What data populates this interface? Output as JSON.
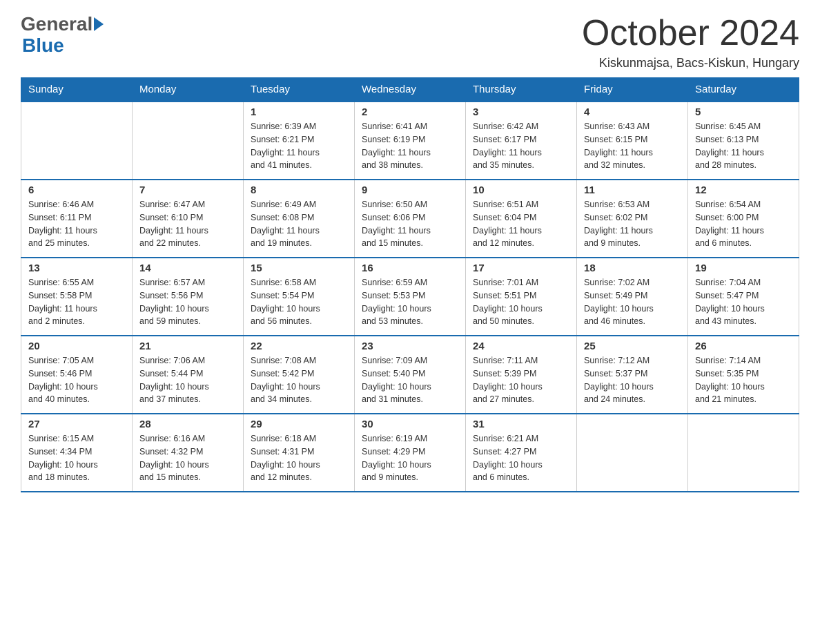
{
  "header": {
    "logo_general": "General",
    "logo_blue": "Blue",
    "month_title": "October 2024",
    "location": "Kiskunmajsa, Bacs-Kiskun, Hungary"
  },
  "weekdays": [
    "Sunday",
    "Monday",
    "Tuesday",
    "Wednesday",
    "Thursday",
    "Friday",
    "Saturday"
  ],
  "weeks": [
    [
      {
        "day": "",
        "info": ""
      },
      {
        "day": "",
        "info": ""
      },
      {
        "day": "1",
        "info": "Sunrise: 6:39 AM\nSunset: 6:21 PM\nDaylight: 11 hours\nand 41 minutes."
      },
      {
        "day": "2",
        "info": "Sunrise: 6:41 AM\nSunset: 6:19 PM\nDaylight: 11 hours\nand 38 minutes."
      },
      {
        "day": "3",
        "info": "Sunrise: 6:42 AM\nSunset: 6:17 PM\nDaylight: 11 hours\nand 35 minutes."
      },
      {
        "day": "4",
        "info": "Sunrise: 6:43 AM\nSunset: 6:15 PM\nDaylight: 11 hours\nand 32 minutes."
      },
      {
        "day": "5",
        "info": "Sunrise: 6:45 AM\nSunset: 6:13 PM\nDaylight: 11 hours\nand 28 minutes."
      }
    ],
    [
      {
        "day": "6",
        "info": "Sunrise: 6:46 AM\nSunset: 6:11 PM\nDaylight: 11 hours\nand 25 minutes."
      },
      {
        "day": "7",
        "info": "Sunrise: 6:47 AM\nSunset: 6:10 PM\nDaylight: 11 hours\nand 22 minutes."
      },
      {
        "day": "8",
        "info": "Sunrise: 6:49 AM\nSunset: 6:08 PM\nDaylight: 11 hours\nand 19 minutes."
      },
      {
        "day": "9",
        "info": "Sunrise: 6:50 AM\nSunset: 6:06 PM\nDaylight: 11 hours\nand 15 minutes."
      },
      {
        "day": "10",
        "info": "Sunrise: 6:51 AM\nSunset: 6:04 PM\nDaylight: 11 hours\nand 12 minutes."
      },
      {
        "day": "11",
        "info": "Sunrise: 6:53 AM\nSunset: 6:02 PM\nDaylight: 11 hours\nand 9 minutes."
      },
      {
        "day": "12",
        "info": "Sunrise: 6:54 AM\nSunset: 6:00 PM\nDaylight: 11 hours\nand 6 minutes."
      }
    ],
    [
      {
        "day": "13",
        "info": "Sunrise: 6:55 AM\nSunset: 5:58 PM\nDaylight: 11 hours\nand 2 minutes."
      },
      {
        "day": "14",
        "info": "Sunrise: 6:57 AM\nSunset: 5:56 PM\nDaylight: 10 hours\nand 59 minutes."
      },
      {
        "day": "15",
        "info": "Sunrise: 6:58 AM\nSunset: 5:54 PM\nDaylight: 10 hours\nand 56 minutes."
      },
      {
        "day": "16",
        "info": "Sunrise: 6:59 AM\nSunset: 5:53 PM\nDaylight: 10 hours\nand 53 minutes."
      },
      {
        "day": "17",
        "info": "Sunrise: 7:01 AM\nSunset: 5:51 PM\nDaylight: 10 hours\nand 50 minutes."
      },
      {
        "day": "18",
        "info": "Sunrise: 7:02 AM\nSunset: 5:49 PM\nDaylight: 10 hours\nand 46 minutes."
      },
      {
        "day": "19",
        "info": "Sunrise: 7:04 AM\nSunset: 5:47 PM\nDaylight: 10 hours\nand 43 minutes."
      }
    ],
    [
      {
        "day": "20",
        "info": "Sunrise: 7:05 AM\nSunset: 5:46 PM\nDaylight: 10 hours\nand 40 minutes."
      },
      {
        "day": "21",
        "info": "Sunrise: 7:06 AM\nSunset: 5:44 PM\nDaylight: 10 hours\nand 37 minutes."
      },
      {
        "day": "22",
        "info": "Sunrise: 7:08 AM\nSunset: 5:42 PM\nDaylight: 10 hours\nand 34 minutes."
      },
      {
        "day": "23",
        "info": "Sunrise: 7:09 AM\nSunset: 5:40 PM\nDaylight: 10 hours\nand 31 minutes."
      },
      {
        "day": "24",
        "info": "Sunrise: 7:11 AM\nSunset: 5:39 PM\nDaylight: 10 hours\nand 27 minutes."
      },
      {
        "day": "25",
        "info": "Sunrise: 7:12 AM\nSunset: 5:37 PM\nDaylight: 10 hours\nand 24 minutes."
      },
      {
        "day": "26",
        "info": "Sunrise: 7:14 AM\nSunset: 5:35 PM\nDaylight: 10 hours\nand 21 minutes."
      }
    ],
    [
      {
        "day": "27",
        "info": "Sunrise: 6:15 AM\nSunset: 4:34 PM\nDaylight: 10 hours\nand 18 minutes."
      },
      {
        "day": "28",
        "info": "Sunrise: 6:16 AM\nSunset: 4:32 PM\nDaylight: 10 hours\nand 15 minutes."
      },
      {
        "day": "29",
        "info": "Sunrise: 6:18 AM\nSunset: 4:31 PM\nDaylight: 10 hours\nand 12 minutes."
      },
      {
        "day": "30",
        "info": "Sunrise: 6:19 AM\nSunset: 4:29 PM\nDaylight: 10 hours\nand 9 minutes."
      },
      {
        "day": "31",
        "info": "Sunrise: 6:21 AM\nSunset: 4:27 PM\nDaylight: 10 hours\nand 6 minutes."
      },
      {
        "day": "",
        "info": ""
      },
      {
        "day": "",
        "info": ""
      }
    ]
  ]
}
